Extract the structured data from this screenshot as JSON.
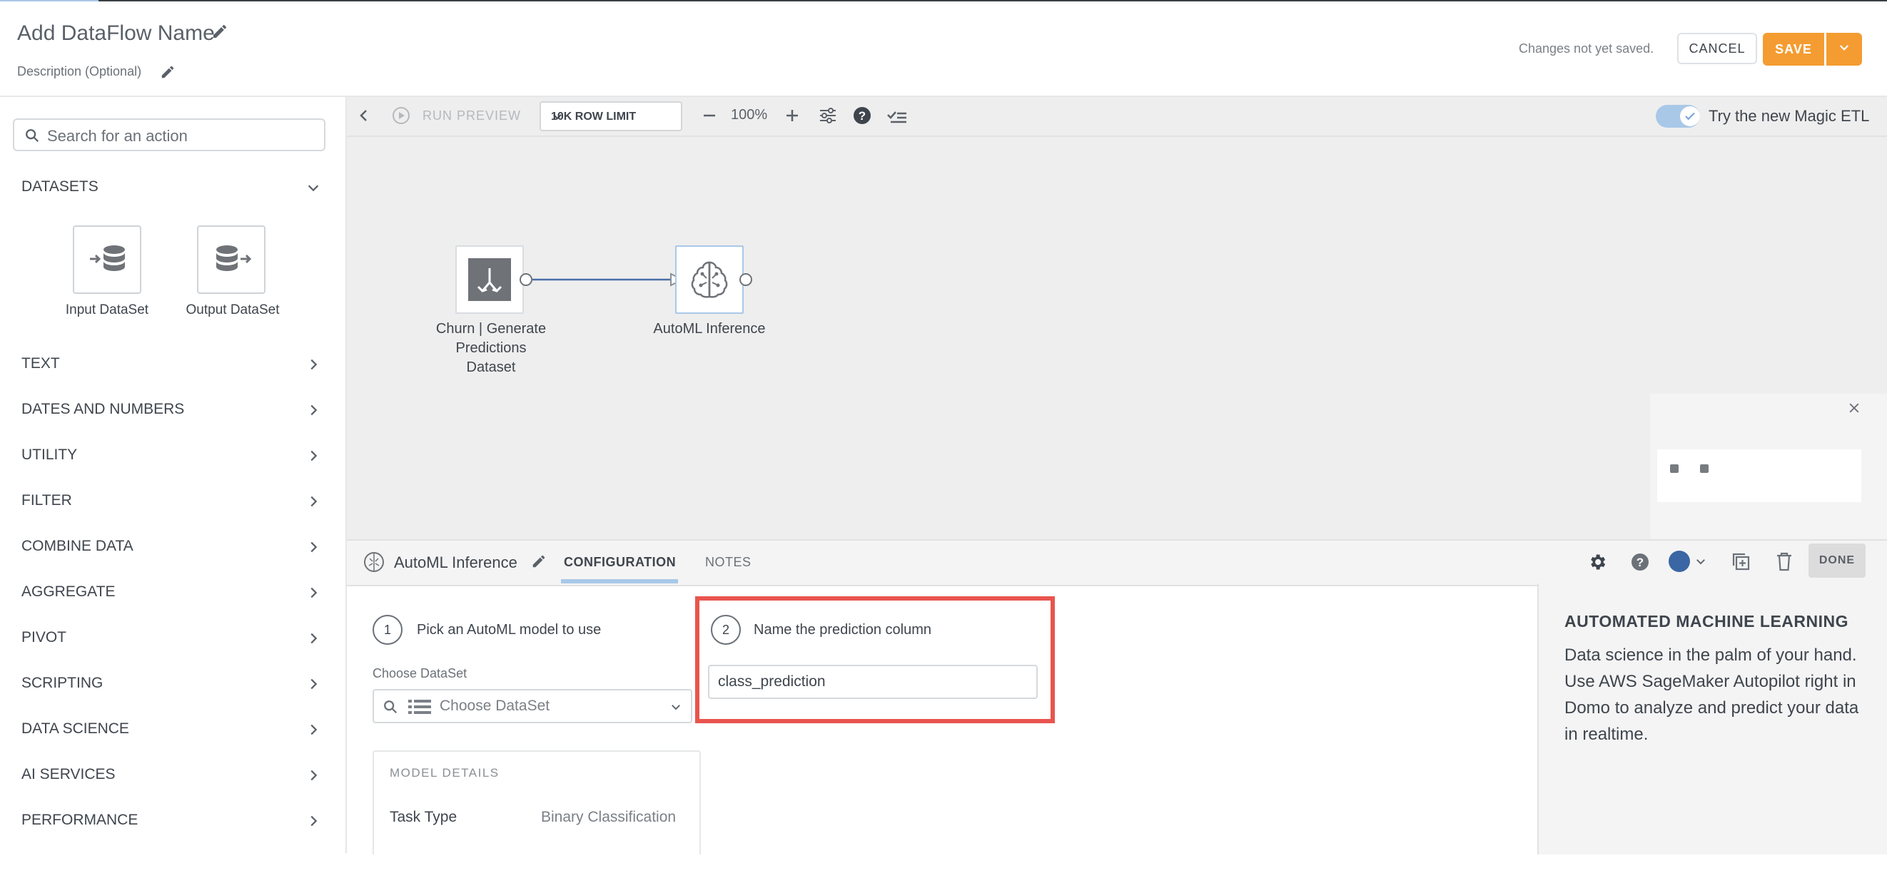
{
  "header": {
    "title": "Add DataFlow Name",
    "description": "Description (Optional)",
    "status": "Changes not yet saved.",
    "cancel_label": "CANCEL",
    "save_label": "SAVE"
  },
  "left_panel": {
    "search_placeholder": "Search for an action",
    "datasets_label": "DATASETS",
    "tiles": [
      {
        "label": "Input DataSet",
        "icon": "input-dataset-icon"
      },
      {
        "label": "Output DataSet",
        "icon": "output-dataset-icon"
      }
    ],
    "categories": [
      "TEXT",
      "DATES AND NUMBERS",
      "UTILITY",
      "FILTER",
      "COMBINE DATA",
      "AGGREGATE",
      "PIVOT",
      "SCRIPTING",
      "DATA SCIENCE",
      "AI SERVICES",
      "PERFORMANCE"
    ]
  },
  "toolbar": {
    "run_preview": "RUN PREVIEW",
    "row_limit": "10K ROW LIMIT",
    "zoom": "100%",
    "magic_etl_label": "Try the new Magic ETL",
    "magic_etl_on": true
  },
  "canvas": {
    "nodes": [
      {
        "label_lines": [
          "Churn | Generate",
          "Predictions",
          "Dataset"
        ]
      },
      {
        "label_lines": [
          "AutoML Inference"
        ]
      }
    ]
  },
  "config_panel": {
    "title": "AutoML Inference",
    "tabs": [
      "CONFIGURATION",
      "NOTES"
    ],
    "active_tab": "CONFIGURATION",
    "done_label": "DONE",
    "node_color": "#3a66a3",
    "step1": {
      "number": "1",
      "label": "Pick an AutoML model to use"
    },
    "choose_dataset_label": "Choose DataSet",
    "choose_dataset_placeholder": "Choose DataSet",
    "step2": {
      "number": "2",
      "label": "Name the prediction column"
    },
    "prediction_column_value": "class_prediction",
    "model_details": {
      "heading": "MODEL DETAILS",
      "task_type_label": "Task Type",
      "task_type_value": "Binary Classification"
    }
  },
  "info_panel": {
    "title": "AUTOMATED MACHINE LEARNING",
    "body": "Data science in the palm of your hand. Use AWS SageMaker Autopilot right in Domo to analyze and predict your data in realtime."
  },
  "colors": {
    "accent_orange": "#f49c32",
    "highlight_red": "#e8554e",
    "toggle_blue": "#a9c8e8"
  }
}
